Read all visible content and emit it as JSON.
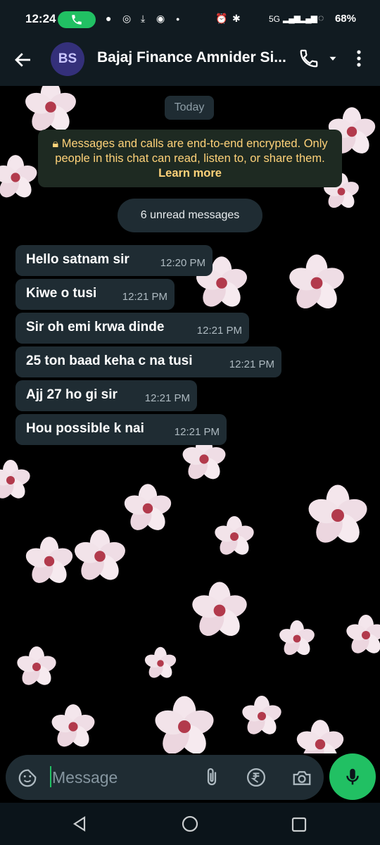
{
  "status_bar": {
    "time": "12:24",
    "battery": "68%",
    "network": "5G"
  },
  "header": {
    "avatar_initials": "BS",
    "contact_name": "Bajaj Finance Amnider Si..."
  },
  "chat": {
    "date_label": "Today",
    "encryption_notice": "Messages and calls are end-to-end encrypted. Only people in this chat can read, listen to, or share them.",
    "encryption_link": "Learn more",
    "unread_label": "6 unread messages",
    "messages": [
      {
        "text": "Hello satnam sir",
        "time": "12:20 PM"
      },
      {
        "text": "Kiwe o tusi",
        "time": "12:21 PM"
      },
      {
        "text": "Sir oh emi krwa dinde",
        "time": "12:21 PM"
      },
      {
        "text": "25 ton baad keha c na tusi",
        "time": "12:21 PM"
      },
      {
        "text": "Ajj 27 ho gi sir",
        "time": "12:21 PM"
      },
      {
        "text": "Hou possible k nai",
        "time": "12:21 PM"
      }
    ]
  },
  "composer": {
    "placeholder": "Message"
  },
  "icons": [
    "back-arrow-icon",
    "phone-icon",
    "chevron-down-icon",
    "more-vert-icon",
    "sticker-icon",
    "attach-icon",
    "rupee-icon",
    "camera-icon",
    "mic-icon"
  ],
  "colors": {
    "accent": "#21c063",
    "bubble": "#1f2c33",
    "bar": "#111b21",
    "notice_text": "#ffd279"
  }
}
